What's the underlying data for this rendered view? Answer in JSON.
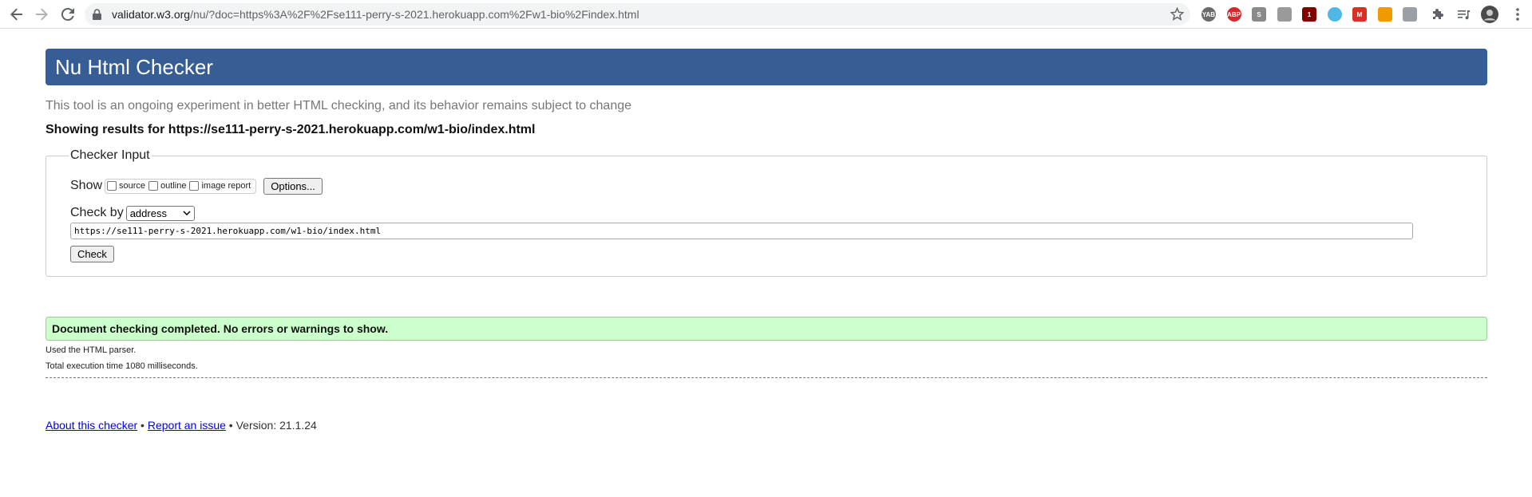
{
  "browser": {
    "url_host": "validator.w3.org",
    "url_rest": "/nu/?doc=https%3A%2F%2Fse111-perry-s-2021.herokuapp.com%2Fw1-bio%2Findex.html",
    "extensions": [
      {
        "name": "yab-extension-icon",
        "label": "YAB",
        "color": "#6b6b6b"
      },
      {
        "name": "adblock-plus-icon",
        "label": "ABP",
        "color": "#d8262b"
      },
      {
        "name": "s-extension-icon",
        "label": "S",
        "color": "#8a8a8a"
      },
      {
        "name": "picture-extension-icon",
        "label": "",
        "color": "#9a9a9a"
      },
      {
        "name": "ublock-origin-icon",
        "label": "1",
        "color": "#800000"
      },
      {
        "name": "search-extension-icon",
        "label": "",
        "color": "#4fb6e6"
      },
      {
        "name": "red-extension-icon",
        "label": "M",
        "color": "#d93025"
      },
      {
        "name": "orange-extension-icon",
        "label": "",
        "color": "#f29900"
      },
      {
        "name": "rectangle-extension-icon",
        "label": "",
        "color": "#9aa0a6"
      }
    ]
  },
  "header": {
    "title": "Nu Html Checker"
  },
  "tagline": "This tool is an ongoing experiment in better HTML checking, and its behavior remains subject to change",
  "results_for": "Showing results for https://se111-perry-s-2021.herokuapp.com/w1-bio/index.html",
  "checker_input": {
    "legend": "Checker Input",
    "show_label": "Show",
    "options": [
      "source",
      "outline",
      "image report"
    ],
    "options_button": "Options...",
    "check_by_label": "Check by",
    "check_by_value": "address",
    "url_value": "https://se111-perry-s-2021.herokuapp.com/w1-bio/index.html",
    "check_button": "Check"
  },
  "result": {
    "message": "Document checking completed. No errors or warnings to show.",
    "parser": "Used the HTML parser.",
    "execution_time": "Total execution time 1080 milliseconds."
  },
  "footer": {
    "about_link": "About this checker",
    "separator": " • ",
    "report_link": "Report an issue",
    "version": " • Version: 21.1.24"
  }
}
